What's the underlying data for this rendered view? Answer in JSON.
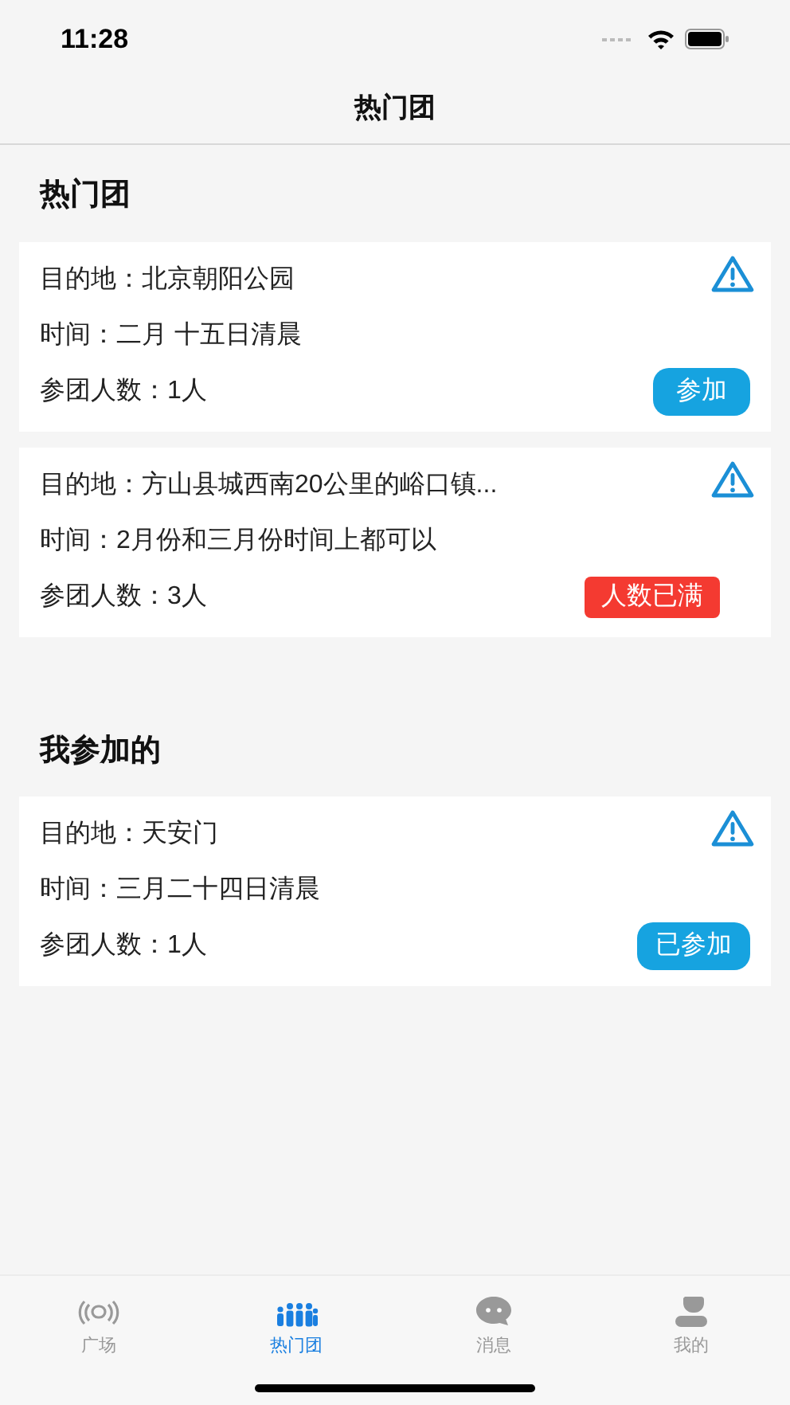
{
  "status_bar": {
    "time": "11:28"
  },
  "nav": {
    "title": "热门团"
  },
  "sections": [
    {
      "title": "热门团",
      "cards": [
        {
          "destination": "目的地：北京朝阳公园",
          "time": "时间：二月 十五日清晨",
          "members": "参团人数：1人",
          "action": {
            "kind": "join",
            "label": "参加"
          }
        },
        {
          "destination": "目的地：方山县城西南20公里的峪口镇...",
          "time": "时间：2月份和三月份时间上都可以",
          "members": "参团人数：3人",
          "action": {
            "kind": "full",
            "label": "人数已满"
          }
        }
      ]
    },
    {
      "title": "我参加的",
      "cards": [
        {
          "destination": "目的地：天安门",
          "time": "时间：三月二十四日清晨",
          "members": "参团人数：1人",
          "action": {
            "kind": "joined",
            "label": "已参加"
          }
        }
      ]
    }
  ],
  "tab_bar": [
    {
      "label": "广场",
      "selected": false
    },
    {
      "label": "热门团",
      "selected": true
    },
    {
      "label": "消息",
      "selected": false
    },
    {
      "label": "我的",
      "selected": false
    }
  ]
}
